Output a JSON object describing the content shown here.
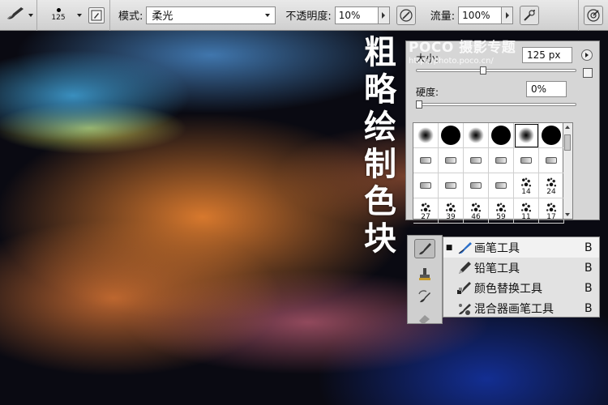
{
  "options_bar": {
    "brush_size": "125",
    "mode_label": "模式:",
    "mode_value": "柔光",
    "opacity_label": "不透明度:",
    "opacity_value": "10%",
    "flow_label": "流量:",
    "flow_value": "100%"
  },
  "overlay": {
    "title_chars": [
      "粗",
      "略",
      "绘",
      "制",
      "色",
      "块"
    ],
    "watermark_title": "POCO 摄影专题",
    "watermark_url": "http://photo.poco.cn/"
  },
  "brush_picker": {
    "size_label": "大小:",
    "size_value": "125 px",
    "size_level_percent": 42,
    "hardness_label": "硬度:",
    "hardness_value": "0%",
    "hardness_level_percent": 0,
    "presets": [
      {
        "kind": "soft",
        "num": ""
      },
      {
        "kind": "hard",
        "num": ""
      },
      {
        "kind": "soft",
        "num": ""
      },
      {
        "kind": "hard",
        "num": ""
      },
      {
        "kind": "soft",
        "num": ""
      },
      {
        "kind": "hard",
        "num": ""
      },
      {
        "kind": "tip",
        "num": ""
      },
      {
        "kind": "tip",
        "num": ""
      },
      {
        "kind": "tip",
        "num": ""
      },
      {
        "kind": "tip",
        "num": ""
      },
      {
        "kind": "tip",
        "num": ""
      },
      {
        "kind": "tip",
        "num": ""
      },
      {
        "kind": "tip",
        "num": ""
      },
      {
        "kind": "tip",
        "num": ""
      },
      {
        "kind": "tip",
        "num": ""
      },
      {
        "kind": "tip",
        "num": ""
      },
      {
        "kind": "splat",
        "num": "14"
      },
      {
        "kind": "splat",
        "num": "24"
      },
      {
        "kind": "splat",
        "num": "27"
      },
      {
        "kind": "splat",
        "num": "39"
      },
      {
        "kind": "splat",
        "num": "46"
      },
      {
        "kind": "splat",
        "num": "59"
      },
      {
        "kind": "splat",
        "num": "11"
      },
      {
        "kind": "splat",
        "num": "17"
      }
    ]
  },
  "tool_flyout": {
    "items": [
      {
        "label": "画笔工具",
        "key": "B",
        "active": true,
        "icon": "brush-icon"
      },
      {
        "label": "铅笔工具",
        "key": "B",
        "active": false,
        "icon": "pencil-icon"
      },
      {
        "label": "颜色替换工具",
        "key": "B",
        "active": false,
        "icon": "color-replacement-icon"
      },
      {
        "label": "混合器画笔工具",
        "key": "B",
        "active": false,
        "icon": "mixer-brush-icon"
      }
    ]
  },
  "colors": {
    "accent_blue": "#2a6fc9"
  }
}
